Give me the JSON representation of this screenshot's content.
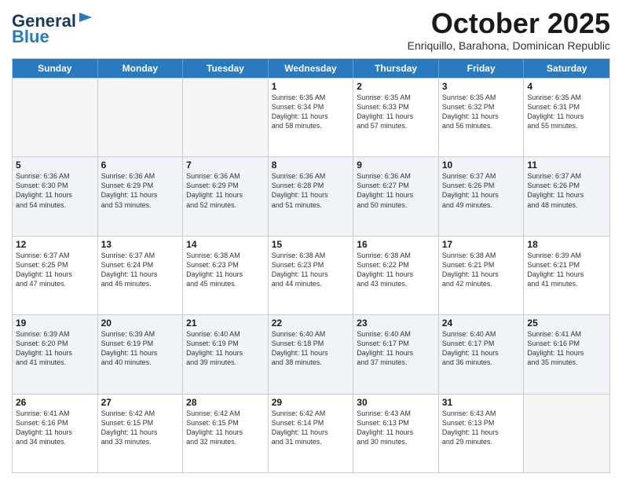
{
  "header": {
    "logo_line1": "General",
    "logo_line2": "Blue",
    "month": "October 2025",
    "location": "Enriquillo, Barahona, Dominican Republic"
  },
  "weekdays": [
    "Sunday",
    "Monday",
    "Tuesday",
    "Wednesday",
    "Thursday",
    "Friday",
    "Saturday"
  ],
  "rows": [
    [
      {
        "day": "",
        "text": "",
        "empty": true
      },
      {
        "day": "",
        "text": "",
        "empty": true
      },
      {
        "day": "",
        "text": "",
        "empty": true
      },
      {
        "day": "1",
        "text": "Sunrise: 6:35 AM\nSunset: 6:34 PM\nDaylight: 11 hours\nand 58 minutes.",
        "empty": false
      },
      {
        "day": "2",
        "text": "Sunrise: 6:35 AM\nSunset: 6:33 PM\nDaylight: 11 hours\nand 57 minutes.",
        "empty": false
      },
      {
        "day": "3",
        "text": "Sunrise: 6:35 AM\nSunset: 6:32 PM\nDaylight: 11 hours\nand 56 minutes.",
        "empty": false
      },
      {
        "day": "4",
        "text": "Sunrise: 6:35 AM\nSunset: 6:31 PM\nDaylight: 11 hours\nand 55 minutes.",
        "empty": false
      }
    ],
    [
      {
        "day": "5",
        "text": "Sunrise: 6:36 AM\nSunset: 6:30 PM\nDaylight: 11 hours\nand 54 minutes.",
        "empty": false
      },
      {
        "day": "6",
        "text": "Sunrise: 6:36 AM\nSunset: 6:29 PM\nDaylight: 11 hours\nand 53 minutes.",
        "empty": false
      },
      {
        "day": "7",
        "text": "Sunrise: 6:36 AM\nSunset: 6:29 PM\nDaylight: 11 hours\nand 52 minutes.",
        "empty": false
      },
      {
        "day": "8",
        "text": "Sunrise: 6:36 AM\nSunset: 6:28 PM\nDaylight: 11 hours\nand 51 minutes.",
        "empty": false
      },
      {
        "day": "9",
        "text": "Sunrise: 6:36 AM\nSunset: 6:27 PM\nDaylight: 11 hours\nand 50 minutes.",
        "empty": false
      },
      {
        "day": "10",
        "text": "Sunrise: 6:37 AM\nSunset: 6:26 PM\nDaylight: 11 hours\nand 49 minutes.",
        "empty": false
      },
      {
        "day": "11",
        "text": "Sunrise: 6:37 AM\nSunset: 6:26 PM\nDaylight: 11 hours\nand 48 minutes.",
        "empty": false
      }
    ],
    [
      {
        "day": "12",
        "text": "Sunrise: 6:37 AM\nSunset: 6:25 PM\nDaylight: 11 hours\nand 47 minutes.",
        "empty": false
      },
      {
        "day": "13",
        "text": "Sunrise: 6:37 AM\nSunset: 6:24 PM\nDaylight: 11 hours\nand 46 minutes.",
        "empty": false
      },
      {
        "day": "14",
        "text": "Sunrise: 6:38 AM\nSunset: 6:23 PM\nDaylight: 11 hours\nand 45 minutes.",
        "empty": false
      },
      {
        "day": "15",
        "text": "Sunrise: 6:38 AM\nSunset: 6:23 PM\nDaylight: 11 hours\nand 44 minutes.",
        "empty": false
      },
      {
        "day": "16",
        "text": "Sunrise: 6:38 AM\nSunset: 6:22 PM\nDaylight: 11 hours\nand 43 minutes.",
        "empty": false
      },
      {
        "day": "17",
        "text": "Sunrise: 6:38 AM\nSunset: 6:21 PM\nDaylight: 11 hours\nand 42 minutes.",
        "empty": false
      },
      {
        "day": "18",
        "text": "Sunrise: 6:39 AM\nSunset: 6:21 PM\nDaylight: 11 hours\nand 41 minutes.",
        "empty": false
      }
    ],
    [
      {
        "day": "19",
        "text": "Sunrise: 6:39 AM\nSunset: 6:20 PM\nDaylight: 11 hours\nand 41 minutes.",
        "empty": false
      },
      {
        "day": "20",
        "text": "Sunrise: 6:39 AM\nSunset: 6:19 PM\nDaylight: 11 hours\nand 40 minutes.",
        "empty": false
      },
      {
        "day": "21",
        "text": "Sunrise: 6:40 AM\nSunset: 6:19 PM\nDaylight: 11 hours\nand 39 minutes.",
        "empty": false
      },
      {
        "day": "22",
        "text": "Sunrise: 6:40 AM\nSunset: 6:18 PM\nDaylight: 11 hours\nand 38 minutes.",
        "empty": false
      },
      {
        "day": "23",
        "text": "Sunrise: 6:40 AM\nSunset: 6:17 PM\nDaylight: 11 hours\nand 37 minutes.",
        "empty": false
      },
      {
        "day": "24",
        "text": "Sunrise: 6:40 AM\nSunset: 6:17 PM\nDaylight: 11 hours\nand 36 minutes.",
        "empty": false
      },
      {
        "day": "25",
        "text": "Sunrise: 6:41 AM\nSunset: 6:16 PM\nDaylight: 11 hours\nand 35 minutes.",
        "empty": false
      }
    ],
    [
      {
        "day": "26",
        "text": "Sunrise: 6:41 AM\nSunset: 6:16 PM\nDaylight: 11 hours\nand 34 minutes.",
        "empty": false
      },
      {
        "day": "27",
        "text": "Sunrise: 6:42 AM\nSunset: 6:15 PM\nDaylight: 11 hours\nand 33 minutes.",
        "empty": false
      },
      {
        "day": "28",
        "text": "Sunrise: 6:42 AM\nSunset: 6:15 PM\nDaylight: 11 hours\nand 32 minutes.",
        "empty": false
      },
      {
        "day": "29",
        "text": "Sunrise: 6:42 AM\nSunset: 6:14 PM\nDaylight: 11 hours\nand 31 minutes.",
        "empty": false
      },
      {
        "day": "30",
        "text": "Sunrise: 6:43 AM\nSunset: 6:13 PM\nDaylight: 11 hours\nand 30 minutes.",
        "empty": false
      },
      {
        "day": "31",
        "text": "Sunrise: 6:43 AM\nSunset: 6:13 PM\nDaylight: 11 hours\nand 29 minutes.",
        "empty": false
      },
      {
        "day": "",
        "text": "",
        "empty": true
      }
    ]
  ],
  "alt_rows": [
    1,
    3
  ]
}
